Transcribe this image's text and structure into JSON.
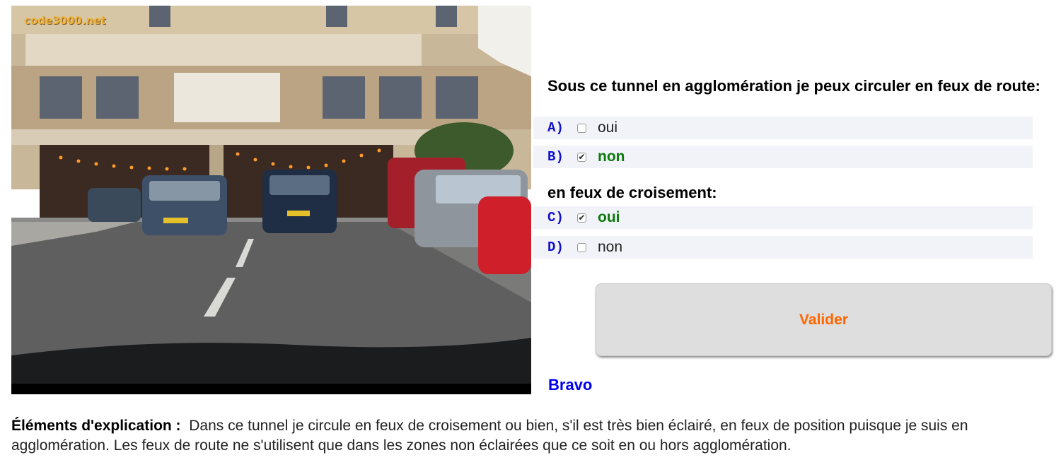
{
  "image": {
    "watermark": "code3000.net",
    "description_icon": "road-tunnel-photo"
  },
  "question": {
    "title": "Sous ce tunnel en agglomération je peux circuler en feux de route:",
    "subquestion": "en feux de croisement:",
    "options": [
      {
        "letter": "A)",
        "label": "oui",
        "checked": false,
        "correct": false
      },
      {
        "letter": "B)",
        "label": "non",
        "checked": true,
        "correct": true
      },
      {
        "letter": "C)",
        "label": "oui",
        "checked": true,
        "correct": true
      },
      {
        "letter": "D)",
        "label": "non",
        "checked": false,
        "correct": false
      }
    ]
  },
  "actions": {
    "validate_label": "Valider"
  },
  "result": {
    "text": "Bravo"
  },
  "explanation": {
    "heading": "Éléments d'explication :",
    "body": "Dans ce tunnel je circule en feux de croisement ou bien, s'il est très bien éclairé, en feux de position puisque je suis en agglomération. Les feux de route ne s'utilisent que dans les zones non éclairées que ce soit en ou hors agglomération."
  },
  "colors": {
    "accent": "#ff6600",
    "correct": "#0a7a0a",
    "letter": "#1010cc",
    "result": "#0000ee"
  }
}
